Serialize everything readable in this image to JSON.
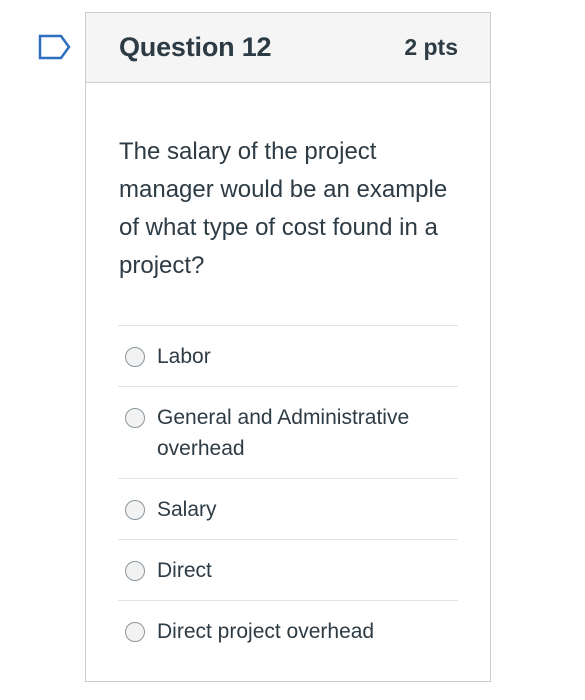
{
  "question": {
    "title": "Question 12",
    "points": "2 pts",
    "text": "The salary of the project manager would be an example of what type of cost found in a project?",
    "flag_icon": "bookmark-flag-icon",
    "accent_color": "#2d6fbf"
  },
  "answers": [
    {
      "label": "Labor",
      "selected": false
    },
    {
      "label": "General and Administrative overhead",
      "selected": false
    },
    {
      "label": "Salary",
      "selected": false
    },
    {
      "label": "Direct",
      "selected": false
    },
    {
      "label": "Direct project overhead",
      "selected": false
    }
  ]
}
